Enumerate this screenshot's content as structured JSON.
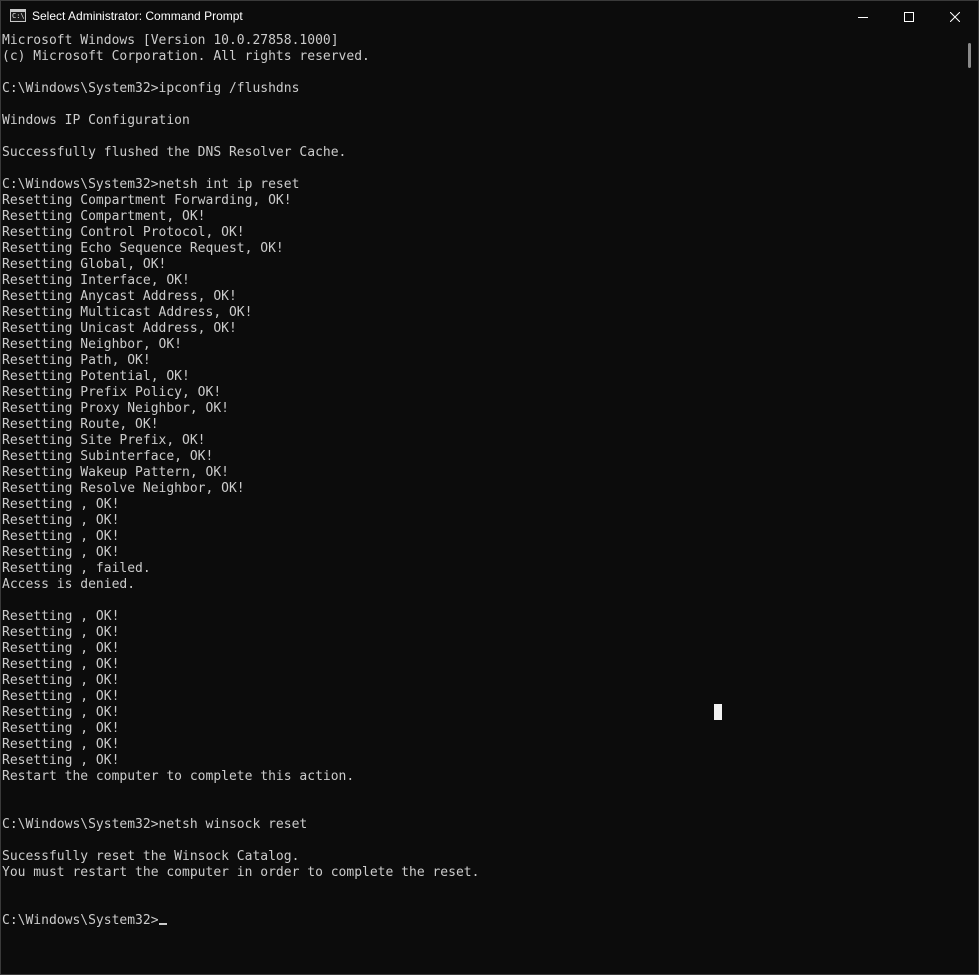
{
  "window": {
    "title": "Select Administrator: Command Prompt",
    "app_icon_glyph": "C:\\"
  },
  "controls": {
    "minimize_icon": "minimize-icon",
    "maximize_icon": "maximize-icon",
    "close_icon": "close-icon"
  },
  "console": {
    "lines": [
      "Microsoft Windows [Version 10.0.27858.1000]",
      "(c) Microsoft Corporation. All rights reserved.",
      "",
      "C:\\Windows\\System32>ipconfig /flushdns",
      "",
      "Windows IP Configuration",
      "",
      "Successfully flushed the DNS Resolver Cache.",
      "",
      "C:\\Windows\\System32>netsh int ip reset",
      "Resetting Compartment Forwarding, OK!",
      "Resetting Compartment, OK!",
      "Resetting Control Protocol, OK!",
      "Resetting Echo Sequence Request, OK!",
      "Resetting Global, OK!",
      "Resetting Interface, OK!",
      "Resetting Anycast Address, OK!",
      "Resetting Multicast Address, OK!",
      "Resetting Unicast Address, OK!",
      "Resetting Neighbor, OK!",
      "Resetting Path, OK!",
      "Resetting Potential, OK!",
      "Resetting Prefix Policy, OK!",
      "Resetting Proxy Neighbor, OK!",
      "Resetting Route, OK!",
      "Resetting Site Prefix, OK!",
      "Resetting Subinterface, OK!",
      "Resetting Wakeup Pattern, OK!",
      "Resetting Resolve Neighbor, OK!",
      "Resetting , OK!",
      "Resetting , OK!",
      "Resetting , OK!",
      "Resetting , OK!",
      "Resetting , failed.",
      "Access is denied.",
      "",
      "Resetting , OK!",
      "Resetting , OK!",
      "Resetting , OK!",
      "Resetting , OK!",
      "Resetting , OK!",
      "Resetting , OK!",
      "Resetting , OK!",
      "Resetting , OK!",
      "Resetting , OK!",
      "Resetting , OK!",
      "Restart the computer to complete this action.",
      "",
      "",
      "C:\\Windows\\System32>netsh winsock reset",
      "",
      "Sucessfully reset the Winsock Catalog.",
      "You must restart the computer in order to complete the reset.",
      "",
      ""
    ],
    "prompt": "C:\\Windows\\System32>"
  },
  "colors": {
    "background": "#0c0c0c",
    "text": "#cccccc",
    "titlebar_text": "#ffffff"
  }
}
